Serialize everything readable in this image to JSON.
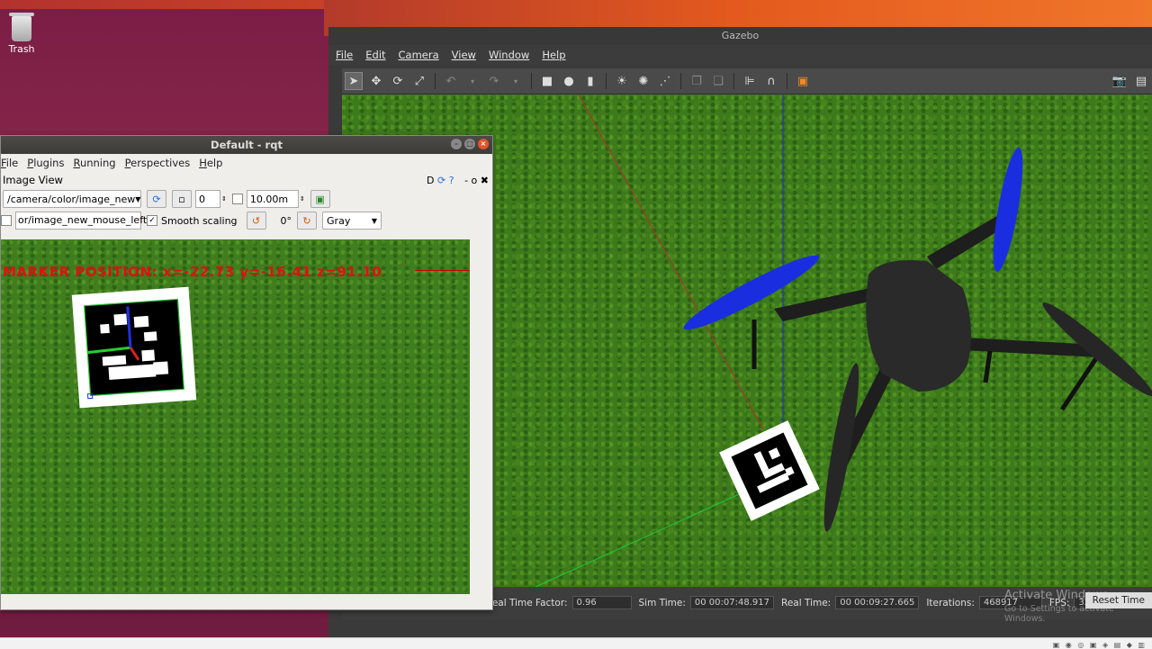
{
  "desktop": {
    "trash_label": "Trash",
    "activate_windows": "Activate Windows",
    "activate_windows_sub": "Go to Settings to activate Windows."
  },
  "gazebo": {
    "title": "Gazebo",
    "menu": [
      "File",
      "Edit",
      "Camera",
      "View",
      "Window",
      "Help"
    ],
    "status": {
      "rtf_label": "Real Time Factor:",
      "rtf_value": "0.96",
      "sim_label": "Sim Time:",
      "sim_value": "00 00:07:48.917",
      "real_label": "Real Time:",
      "real_value": "00 00:09:27.665",
      "iter_label": "Iterations:",
      "iter_value": "468917",
      "fps_label": "FPS:",
      "fps_value": "32.33",
      "reset_label": "Reset Time"
    }
  },
  "rqt": {
    "title": "Default - rqt",
    "menu": [
      "File",
      "Plugins",
      "Running",
      "Perspectives",
      "Help"
    ],
    "plugin_title": "Image View",
    "plugin_controls": "D",
    "topic": "/camera/color/image_new",
    "spin_value": "0",
    "distance": "10.00m",
    "mouse_topic": "or/image_new_mouse_left",
    "smooth_label": "Smooth scaling",
    "rotation": "0°",
    "color_scheme": "Gray",
    "marker_text": "MARKER POSITION: x=-22.73 y=-16.41 z=91.10"
  }
}
